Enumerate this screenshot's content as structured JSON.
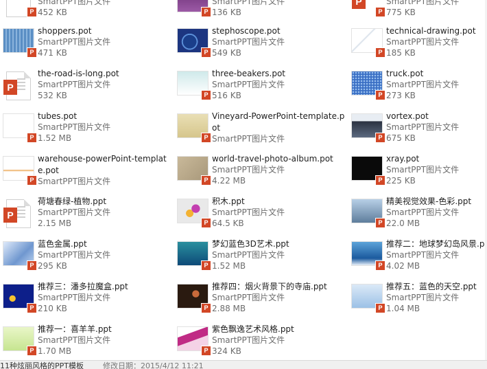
{
  "badge_letter": "P",
  "top_partial": [
    {
      "size": "452 KB",
      "type": "SmartPPT图片文件"
    },
    {
      "size": "136 KB",
      "type": "SmartPPT图片文件"
    },
    {
      "size": "775 KB",
      "type": "SmartPPT图片文件"
    }
  ],
  "files": [
    {
      "name": "shoppers.pot",
      "type": "SmartPPT图片文件",
      "size": "471 KB",
      "thumb": "blue-grid"
    },
    {
      "name": "stephoscope.pot",
      "type": "SmartPPT图片文件",
      "size": "549 KB",
      "thumb": "navy-ring"
    },
    {
      "name": "technical-drawing.pot",
      "type": "SmartPPT图片文件",
      "size": "185 KB",
      "thumb": "sketch"
    },
    {
      "name": "the-road-is-long.pot",
      "type": "SmartPPT图片文件",
      "size": "532 KB",
      "thumb": "doc"
    },
    {
      "name": "three-beakers.pot",
      "type": "SmartPPT图片文件",
      "size": "516 KB",
      "thumb": "teal-grid"
    },
    {
      "name": "truck.pot",
      "type": "SmartPPT图片文件",
      "size": "273 KB",
      "thumb": "blue-dots"
    },
    {
      "name": "tubes.pot",
      "type": "SmartPPT图片文件",
      "size": "1.52 MB",
      "thumb": "white"
    },
    {
      "name": "Vineyard-PowerPoint-template.pot",
      "type": "SmartPPT图片文件",
      "size": "",
      "thumb": "beige"
    },
    {
      "name": "vortex.pot",
      "type": "SmartPPT图片文件",
      "size": "675 KB",
      "thumb": "dark-wave"
    },
    {
      "name": "warehouse-powerPoint-template.pot",
      "type": "SmartPPT图片文件",
      "size": "",
      "thumb": "white-orange"
    },
    {
      "name": "world-travel-photo-album.pot",
      "type": "SmartPPT图片文件",
      "size": "4.22 MB",
      "thumb": "tan-map"
    },
    {
      "name": "xray.pot",
      "type": "SmartPPT图片文件",
      "size": "225 KB",
      "thumb": "black"
    },
    {
      "name": "荷塘春绿-植物.ppt",
      "type": "SmartPPT图片文件",
      "size": "2.15 MB",
      "thumb": "doc"
    },
    {
      "name": "积木.ppt",
      "type": "SmartPPT图片文件",
      "size": "64.5 KB",
      "thumb": "blocks"
    },
    {
      "name": "精美视觉效果-色彩.ppt",
      "type": "SmartPPT图片文件",
      "size": "22.0 MB",
      "thumb": "sky-gray"
    },
    {
      "name": "蓝色金属.ppt",
      "type": "SmartPPT图片文件",
      "size": "295 KB",
      "thumb": "blue-metal"
    },
    {
      "name": "梦幻蓝色3D艺术.ppt",
      "type": "SmartPPT图片文件",
      "size": "1.52 MB",
      "thumb": "teal-3d"
    },
    {
      "name": "推荐二：地球梦幻岛风景.ppt",
      "type": "SmartPPT图片文件",
      "size": "4.02 MB",
      "thumb": "blue-island"
    },
    {
      "name": "推荐三：潘多拉魔盒.ppt",
      "type": "SmartPPT图片文件",
      "size": "210 KB",
      "thumb": "navy-box"
    },
    {
      "name": "推荐四：烟火背景下的寺庙.ppt",
      "type": "SmartPPT图片文件",
      "size": "2.88 MB",
      "thumb": "dark-temple"
    },
    {
      "name": "推荐五：蓝色的天空.ppt",
      "type": "SmartPPT图片文件",
      "size": "1.04 MB",
      "thumb": "light-sky"
    },
    {
      "name": "推荐一：喜羊羊.ppt",
      "type": "SmartPPT图片文件",
      "size": "1.70 MB",
      "thumb": "green-cartoon"
    },
    {
      "name": "紫色飘逸艺术风格.ppt",
      "type": "SmartPPT图片文件",
      "size": "324 KB",
      "thumb": "purple-wave"
    }
  ],
  "status": {
    "left": "11种炫丽风格的PPT模板",
    "middle": "修改日期：2015/4/12 11:21"
  }
}
